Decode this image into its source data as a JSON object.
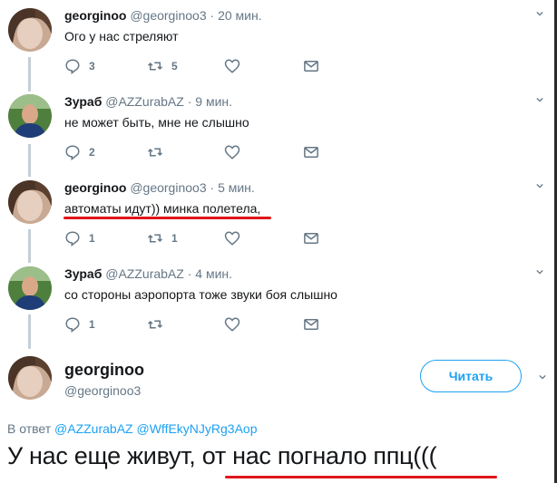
{
  "tweets": [
    {
      "name": "georginoo",
      "handle": "@georginoo3",
      "time": "20 мин.",
      "text": "Ого у нас стреляют",
      "replies": "3",
      "retweets": "5"
    },
    {
      "name": "Зураб",
      "handle": "@AZZurabAZ",
      "time": "9 мин.",
      "text": "не может быть, мне не слышно",
      "replies": "2",
      "retweets": ""
    },
    {
      "name": "georginoo",
      "handle": "@georginoo3",
      "time": "5 мин.",
      "text": "автоматы идут)) минка полетела,",
      "replies": "1",
      "retweets": "1"
    },
    {
      "name": "Зураб",
      "handle": "@AZZurabAZ",
      "time": "4 мин.",
      "text": "со стороны аэропорта тоже звуки боя слышно",
      "replies": "1",
      "retweets": ""
    }
  ],
  "separator": "·",
  "main_tweet": {
    "name": "georginoo",
    "handle": "@georginoo3",
    "follow_label": "Читать",
    "reply_prefix": "В ответ",
    "reply_mention_1": "@AZZurabAZ",
    "reply_mention_2": "@WffEkyNJyRg3Aop",
    "text": "У нас еще живут, от нас погнало ппц((("
  },
  "colors": {
    "accent": "#1da1f2",
    "text": "#14171a",
    "muted": "#657786",
    "underline": "#e0161b",
    "thread_line": "#c4cfd6"
  },
  "icons": [
    "reply-icon",
    "retweet-icon",
    "like-icon",
    "message-icon",
    "chevron-down-icon"
  ]
}
